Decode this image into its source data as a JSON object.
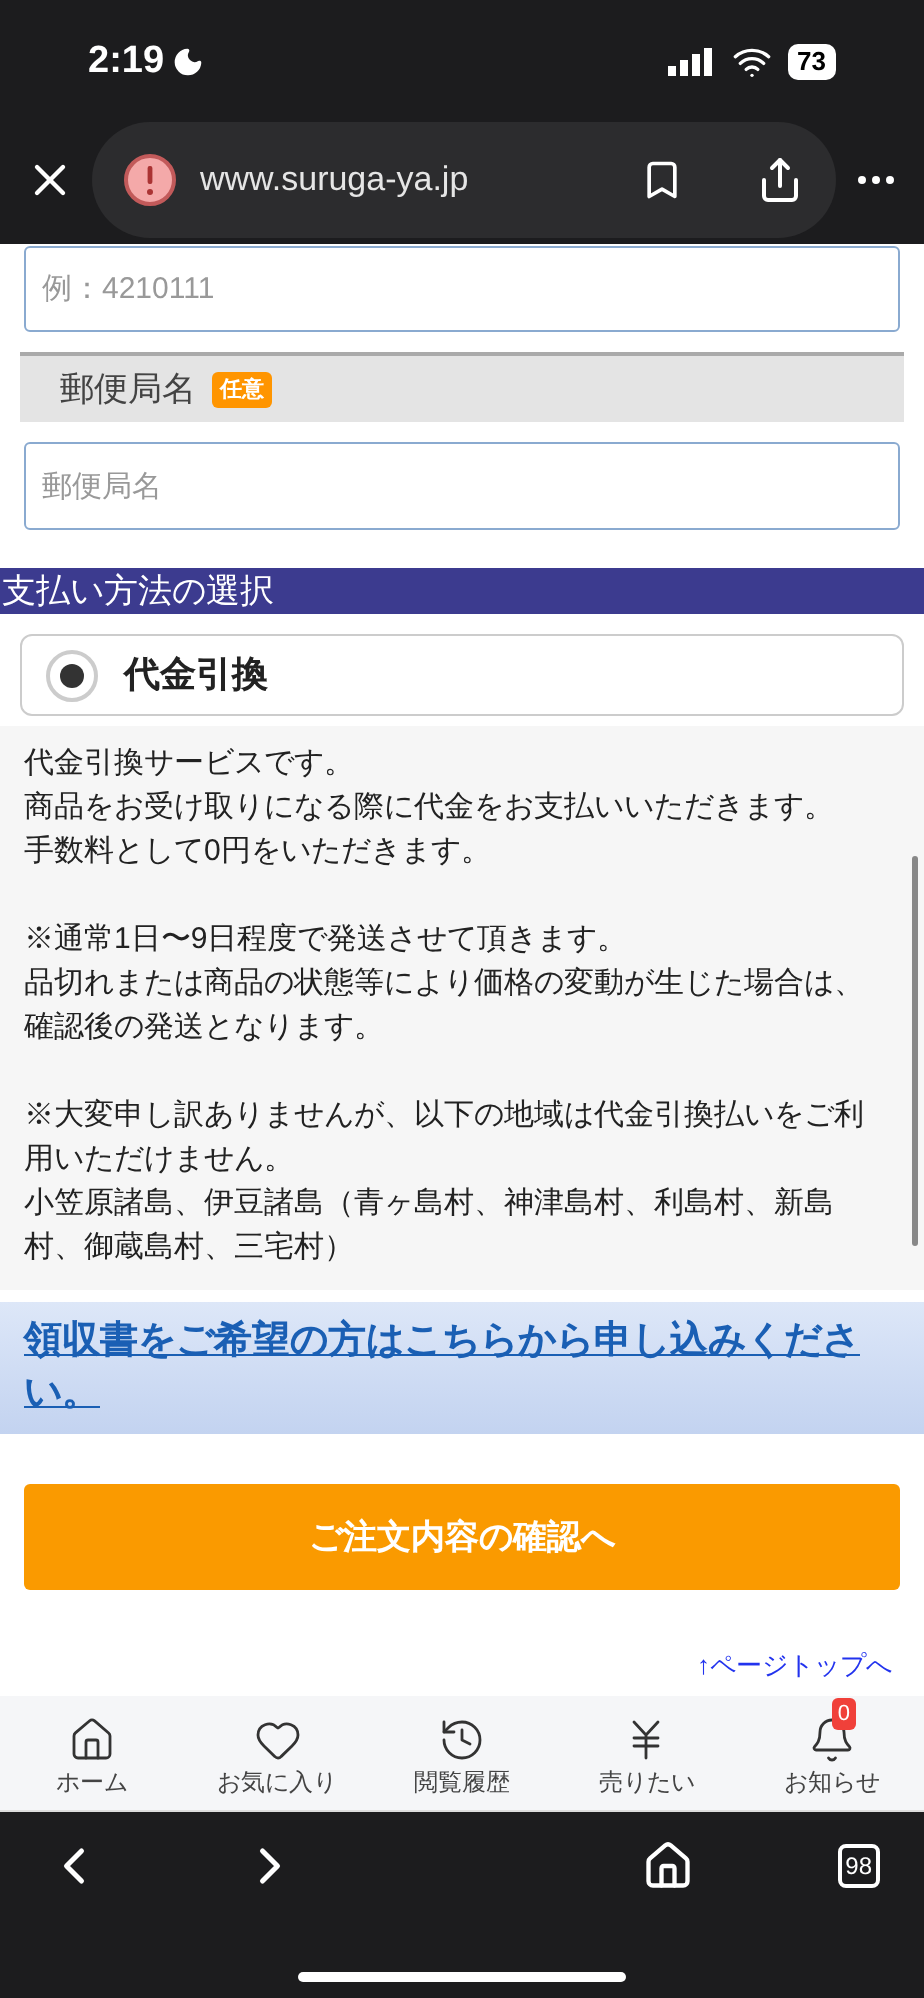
{
  "status_bar": {
    "time": "2:19",
    "battery": "73"
  },
  "browser": {
    "url": "www.suruga-ya.jp"
  },
  "postal_code_field": {
    "placeholder": "例：4210111"
  },
  "post_office_label": {
    "label": "郵便局名",
    "badge": "任意"
  },
  "post_office_field": {
    "placeholder": "郵便局名"
  },
  "payment_header": "支払い方法の選択",
  "payment_option": {
    "label": "代金引換",
    "selected": true
  },
  "description": [
    [
      "代金引換サービスです。",
      "商品をお受け取りになる際に代金をお支払いいただきます。",
      "手数料として0円をいただきます。"
    ],
    [
      "※通常1日〜9日程度で発送させて頂きます。",
      "品切れまたは商品の状態等により価格の変動が生じた場合は、確認後の発送となります。"
    ],
    [
      "※大変申し訳ありませんが、以下の地域は代金引換払いをご利用いただけません。",
      "小笠原諸島、伊豆諸島（青ヶ島村、神津島村、利島村、新島村、御蔵島村、三宅村）"
    ]
  ],
  "receipt_link": "領収書をご希望の方はこちらから申し込みください。",
  "confirm_button": "ご注文内容の確認へ",
  "page_top_link": "↑ページトップへ",
  "tab_bar": [
    {
      "kind": "home",
      "label": "ホーム"
    },
    {
      "kind": "favorite",
      "label": "お気に入り"
    },
    {
      "kind": "history",
      "label": "閲覧履歴"
    },
    {
      "kind": "sell",
      "label": "売りたい"
    },
    {
      "kind": "notice",
      "label": "お知らせ",
      "badge": "0"
    }
  ],
  "browser_toolbar": {
    "tabs_count": "98"
  }
}
